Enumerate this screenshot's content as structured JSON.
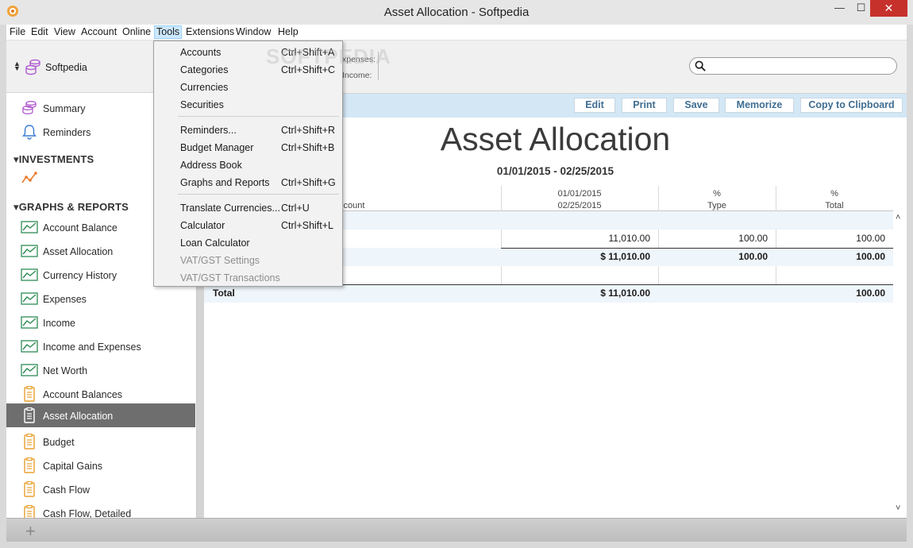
{
  "window": {
    "title": "Asset Allocation - Softpedia",
    "minimize_label": "—",
    "maximize_label": "☐",
    "close_label": "✕"
  },
  "menubar": {
    "items": [
      "File",
      "Edit",
      "View",
      "Account",
      "Online",
      "Tools",
      "Extensions",
      "Window",
      "Help"
    ],
    "active": "Tools"
  },
  "tools_menu": {
    "items": [
      {
        "label": "Accounts",
        "shortcut": "Ctrl+Shift+A"
      },
      {
        "label": "Categories",
        "shortcut": "Ctrl+Shift+C"
      },
      {
        "label": "Currencies",
        "shortcut": ""
      },
      {
        "label": "Securities",
        "shortcut": ""
      },
      {
        "label": "Reminders...",
        "shortcut": "Ctrl+Shift+R"
      },
      {
        "label": "Budget Manager",
        "shortcut": "Ctrl+Shift+B"
      },
      {
        "label": "Address Book",
        "shortcut": ""
      },
      {
        "label": "Graphs and Reports",
        "shortcut": "Ctrl+Shift+G"
      },
      {
        "label": "Translate Currencies...",
        "shortcut": "Ctrl+U"
      },
      {
        "label": "Calculator",
        "shortcut": "Ctrl+Shift+L"
      },
      {
        "label": "Loan Calculator",
        "shortcut": ""
      },
      {
        "label": "VAT/GST Settings",
        "shortcut": ""
      },
      {
        "label": "VAT/GST Transactions",
        "shortcut": ""
      }
    ]
  },
  "sidebar": {
    "account_name": "Softpedia",
    "items_top": [
      "Summary",
      "Reminders"
    ],
    "section_investments": "INVESTMENTS",
    "section_graphs": "GRAPHS & REPORTS",
    "graphs": [
      "Account Balance",
      "Asset Allocation",
      "Currency History",
      "Expenses",
      "Income",
      "Income and Expenses",
      "Net Worth"
    ],
    "reports": [
      "Account Balances",
      "Asset Allocation",
      "Budget",
      "Capital Gains",
      "Cash Flow",
      "Cash Flow, Detailed"
    ],
    "selected": "Asset Allocation"
  },
  "topinfo": {
    "expenses_label": "xpenses:",
    "income_label": "Income:",
    "search_placeholder": ""
  },
  "toolbar": {
    "edit": "Edit",
    "print": "Print",
    "save": "Save",
    "memorize": "Memorize",
    "copy": "Copy to Clipboard"
  },
  "report": {
    "title": "Asset Allocation",
    "dates": "01/01/2015 - 02/25/2015",
    "headers": {
      "account": "ccount",
      "period_line1": "01/01/2015",
      "period_line2": "02/25/2015",
      "type_line1": "%",
      "type_line2": "Type",
      "total_line1": "%",
      "total_line2": "Total"
    },
    "rows": {
      "r1_amount": "11,010.00",
      "r1_type": "100.00",
      "r1_total": "100.00",
      "r2_amount": "$ 11,010.00",
      "r2_type": "100.00",
      "r2_total": "100.00",
      "total_label": "Total",
      "total_amount": "$ 11,010.00",
      "total_total": "100.00"
    }
  },
  "watermark": "SOFTPEDIA",
  "colors": {
    "selected_row": "#6e6e6e",
    "toolbar_bg": "#d3e7f5",
    "button_text": "#3f6d92",
    "close_button": "#c7312b",
    "graph_icon": "#2e8b57",
    "report_icon": "#e8a030",
    "account_icon": "#b05ad0"
  }
}
